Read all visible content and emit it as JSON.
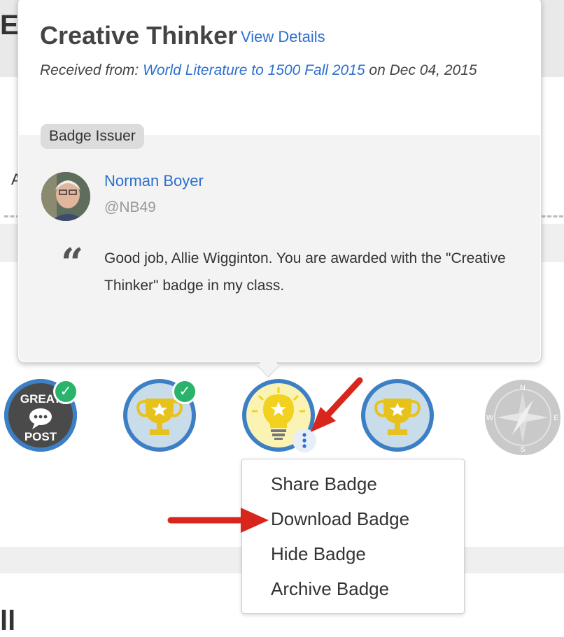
{
  "popover": {
    "badge_name": "Creative Thinker",
    "view_details": "View Details",
    "received_prefix": "Received from:",
    "course": "World Literature to 1500 Fall 2015",
    "date_text": "on Dec 04, 2015",
    "issuer_tag": "Badge Issuer",
    "issuer": {
      "name": "Norman Boyer",
      "handle": "@NB49"
    },
    "message": "Good job, Allie Wigginton. You are awarded with the \"Creative Thinker\" badge in my class."
  },
  "badges": [
    {
      "icon": "great-post-badge-icon",
      "text_top": "GREAT",
      "text_bottom": "POST",
      "earned": true
    },
    {
      "icon": "trophy-badge-icon",
      "earned": true
    },
    {
      "icon": "lightbulb-badge-icon",
      "earned": false,
      "selected": true
    },
    {
      "icon": "trophy-badge-icon",
      "earned": false
    },
    {
      "icon": "compass-badge-icon",
      "earned": false,
      "locked": true,
      "compass": {
        "n": "N",
        "s": "S",
        "e": "E",
        "w": "W"
      }
    }
  ],
  "menu": {
    "items": [
      "Share Badge",
      "Download Badge",
      "Hide Badge",
      "Archive Badge"
    ]
  },
  "colors": {
    "link": "#2b6fcf",
    "badge_ring": "#3d7fc4",
    "badge_fill": "#c8dcea",
    "trophy": "#e8c21c",
    "check": "#2ab36a",
    "annotation_arrow": "#d9261c"
  }
}
